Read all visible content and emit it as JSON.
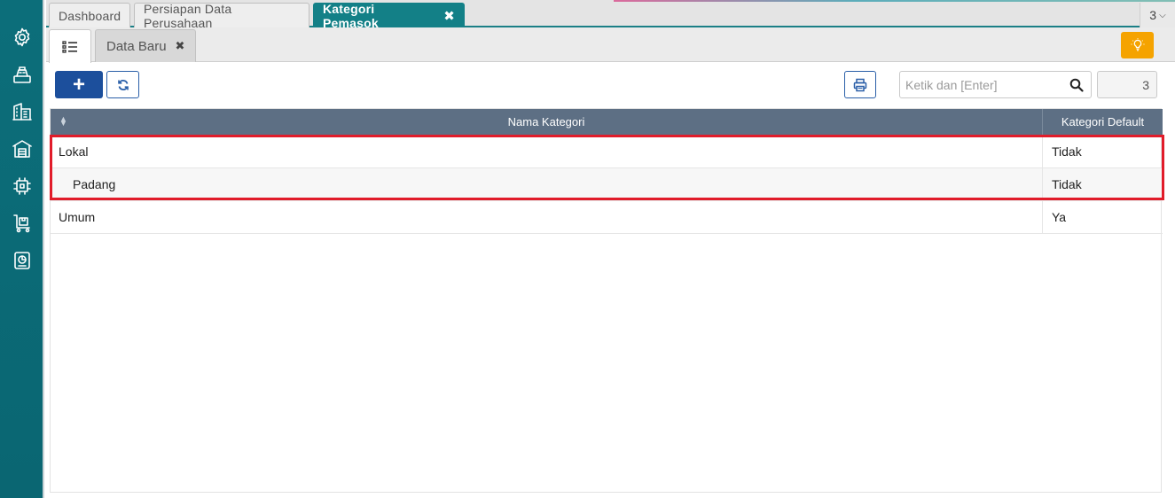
{
  "top_tabs": [
    {
      "label": "Dashboard"
    },
    {
      "label": "Persiapan Data Perusahaan"
    },
    {
      "label": "Kategori Pemasok",
      "active": true
    }
  ],
  "tab_count": "3",
  "sub_tabs": {
    "list_icon": "list-icon",
    "data_baru": "Data Baru"
  },
  "toolbar": {
    "add_icon": "plus-icon",
    "refresh_icon": "refresh-icon",
    "print_icon": "print-icon",
    "search_placeholder": "Ketik dan [Enter]",
    "record_count": "3"
  },
  "table": {
    "columns": [
      "Nama Kategori",
      "Kategori Default"
    ],
    "rows": [
      {
        "name": "Lokal",
        "default": "Tidak",
        "level": 0
      },
      {
        "name": "Padang",
        "default": "Tidak",
        "level": 1
      },
      {
        "name": "Umum",
        "default": "Ya",
        "level": 0
      }
    ]
  },
  "sidebar": {
    "items": [
      "settings-icon",
      "cash-register-icon",
      "building-icon",
      "warehouse-icon",
      "logistics-icon",
      "cart-icon",
      "report-icon"
    ]
  },
  "colors": {
    "sidebar": "#0c6e7a",
    "active_tab": "#138087",
    "add_button": "#1c4f9c",
    "bulb_button": "#f5a300",
    "table_header": "#5d6f84",
    "highlight": "#e11c2a"
  }
}
